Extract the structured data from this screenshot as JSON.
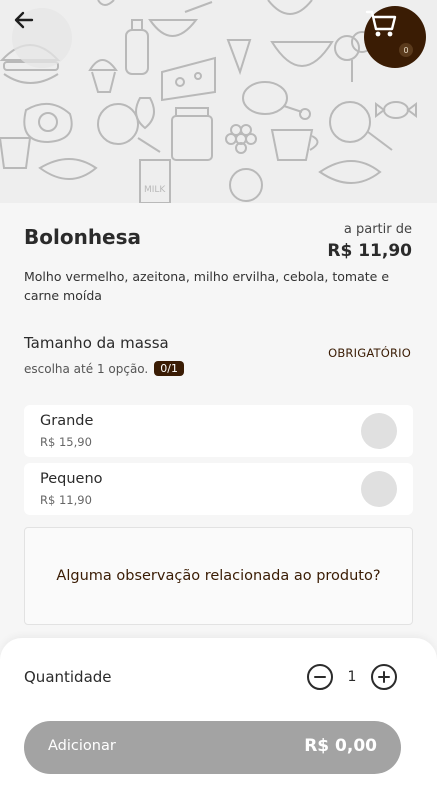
{
  "product": {
    "name": "Bolonhesa",
    "price_prefix": "a partir de",
    "price": "R$ 11,90",
    "description": "Molho vermelho, azeitona, milho ervilha, cebola, tomate e carne moída"
  },
  "cart": {
    "count": "0"
  },
  "option_group": {
    "title": "Tamanho da massa",
    "hint": "escolha até 1 opção.",
    "counter": "0/1",
    "required_label": "OBRIGATÓRIO",
    "options": [
      {
        "name": "Grande",
        "price": "R$ 15,90"
      },
      {
        "name": "Pequeno",
        "price": "R$ 11,90"
      }
    ]
  },
  "observation": {
    "placeholder": "Alguma observação relacionada ao produto?"
  },
  "quantity": {
    "label": "Quantidade",
    "value": "1"
  },
  "add_button": {
    "label": "Adicionar",
    "total": "R$ 0,00"
  },
  "icons": {
    "back": "arrow-left-icon",
    "cart": "shopping-cart-icon",
    "minus": "minus-circle-icon",
    "plus": "plus-circle-icon"
  },
  "colors": {
    "brand": "#3a1c04",
    "button_disabled": "#a3a3a3",
    "background": "#f6f6f6"
  }
}
